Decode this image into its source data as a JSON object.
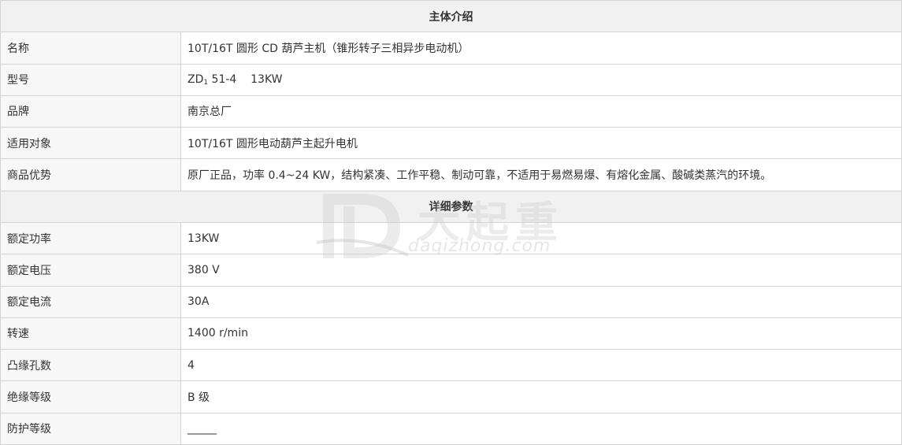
{
  "sections": {
    "intro_title": "主体介绍",
    "params_title": "详细参数"
  },
  "intro": [
    {
      "label": "名称",
      "value": "10T/16T 圆形 CD 葫芦主机（锥形转子三相异步电动机）"
    },
    {
      "label": "型号",
      "value_prefix": "ZD",
      "value_sub": "1",
      "value_suffix": " 51-4    13KW"
    },
    {
      "label": "品牌",
      "value": "南京总厂"
    },
    {
      "label": "适用对象",
      "value": "10T/16T 圆形电动葫芦主起升电机"
    },
    {
      "label": "商品优势",
      "value": "原厂正品，功率 0.4~24 KW，结构紧凑、工作平稳、制动可靠，不适用于易燃易爆、有熔化金属、酸碱类蒸汽的环境。"
    }
  ],
  "params": [
    {
      "label": "额定功率",
      "value": "13KW"
    },
    {
      "label": "额定电压",
      "value": "380 V"
    },
    {
      "label": "额定电流",
      "value": "30A"
    },
    {
      "label": "转速",
      "value": "1400 r/min"
    },
    {
      "label": "凸缘孔数",
      "value": "4"
    },
    {
      "label": "绝缘等级",
      "value": "B 级"
    },
    {
      "label": "防护等级",
      "value": "______"
    }
  ],
  "watermark": {
    "brand_cn": "大起重",
    "brand_en": "daqizhong.com",
    "color": "#c8c8c8"
  }
}
